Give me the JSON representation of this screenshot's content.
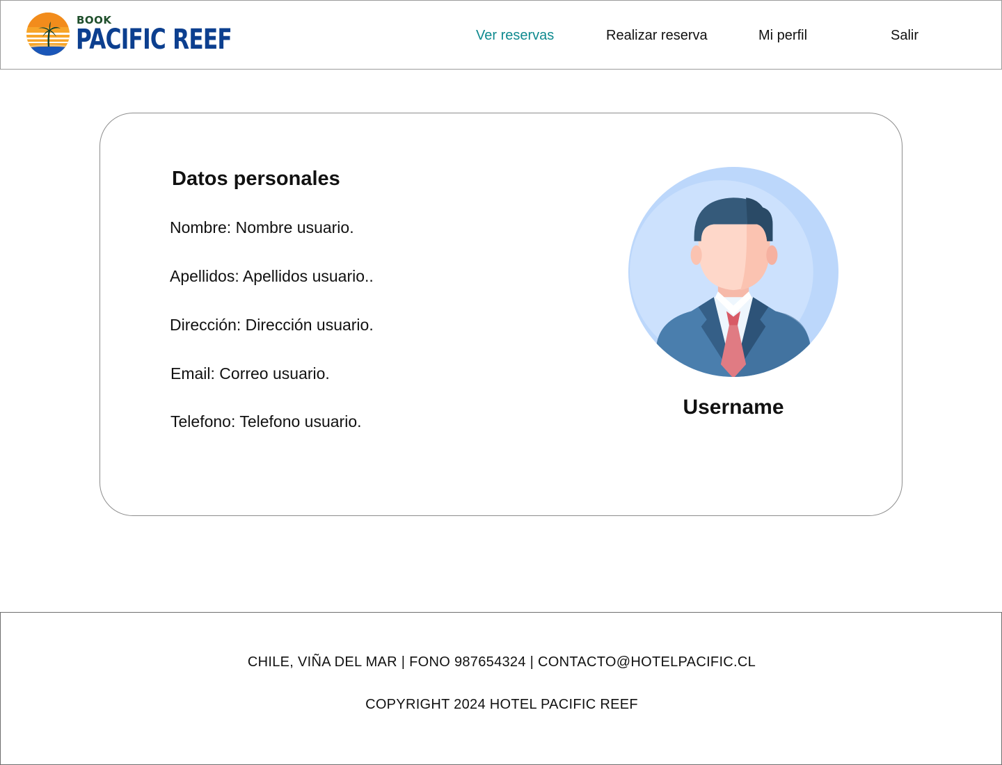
{
  "header": {
    "logo": {
      "small_text": "BOOK",
      "big_text": "PACIFIC REEF"
    },
    "nav": [
      {
        "label": "Ver reservas",
        "active": true
      },
      {
        "label": "Realizar reserva",
        "active": false
      },
      {
        "label": "Mi perfil",
        "active": false
      },
      {
        "label": "Salir",
        "active": false
      }
    ]
  },
  "profile": {
    "section_title": "Datos personales",
    "fields": [
      "Nombre: Nombre usuario.",
      "Apellidos: Apellidos usuario..",
      "Dirección: Dirección usuario.",
      "Email: Correo usuario.",
      "Telefono: Telefono usuario."
    ],
    "username": "Username"
  },
  "footer": {
    "contact_line": "CHILE, VIÑA DEL MAR | FONO 987654324 | CONTACTO@HOTELPACIFIC.CL",
    "copyright": "COPYRIGHT 2024 HOTEL PACIFIC REEF"
  },
  "colors": {
    "nav_active": "#0f8a8f",
    "logo_blue": "#0c3f8f",
    "logo_sun": "#f39a1e"
  },
  "icons": {
    "logo": "sun-palm-icon",
    "avatar": "businessman-avatar-icon"
  }
}
